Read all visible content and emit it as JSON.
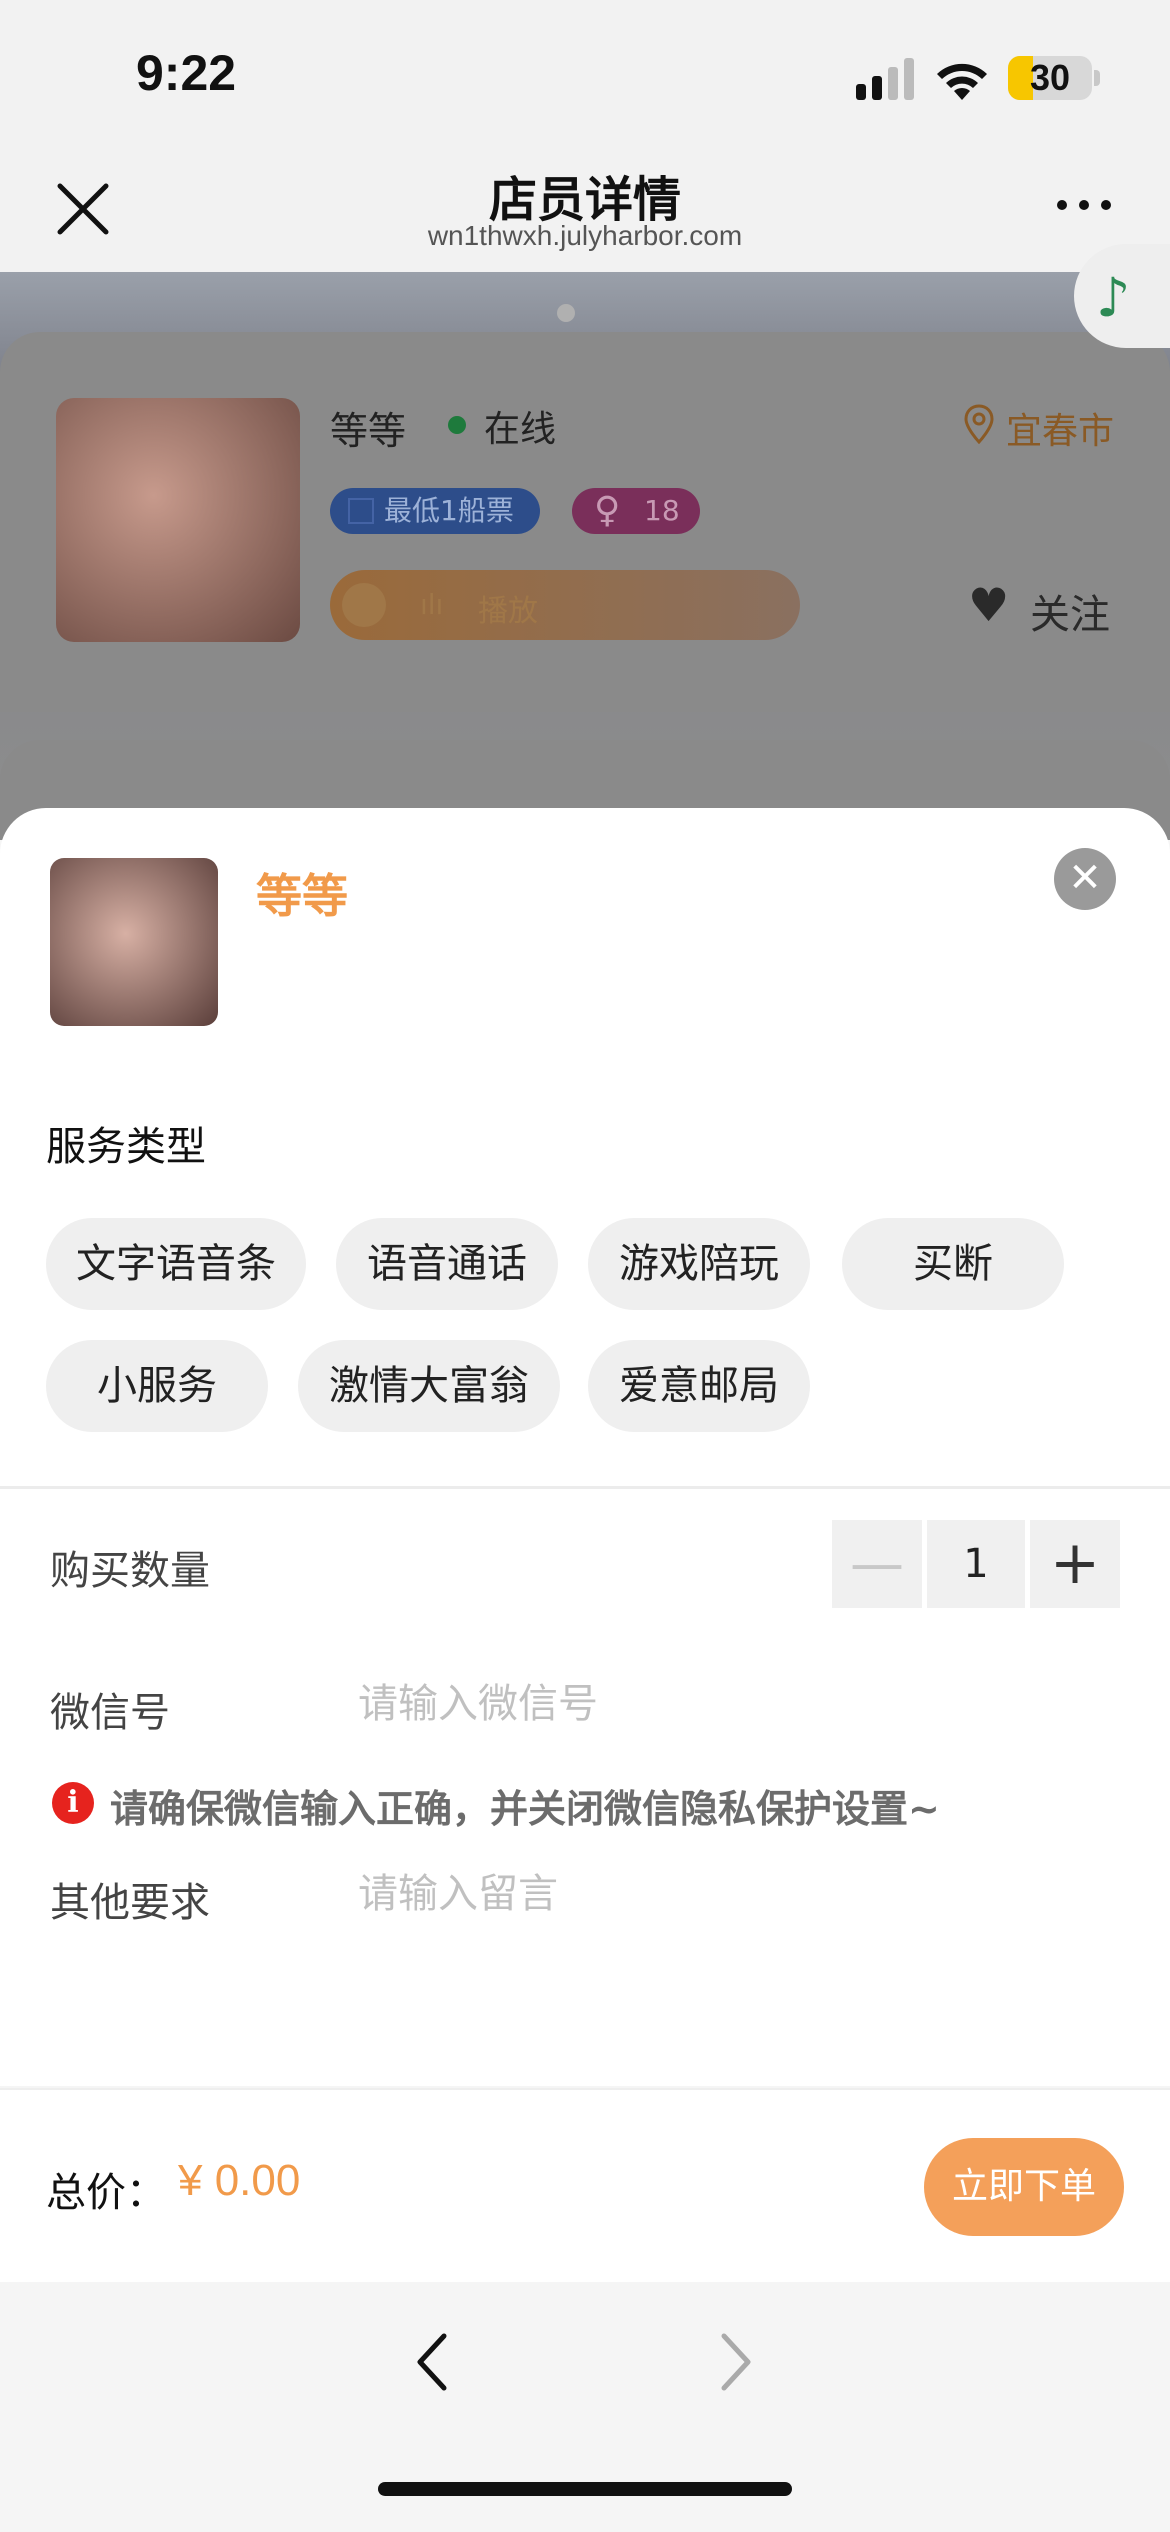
{
  "status_bar": {
    "time": "9:22",
    "battery": "30",
    "battery_level": 0.3
  },
  "nav": {
    "title": "店员详情",
    "url": "wn1thwxh.julyharbor.com"
  },
  "profile": {
    "name": "等等",
    "status": "在线",
    "location": "宜春市",
    "tag_price": "最低1船票",
    "tag_age": "18",
    "audio_label": "播放",
    "follow_label": "关注"
  },
  "sheet": {
    "name": "等等",
    "close_symbol": "✕",
    "service_title": "服务类型",
    "services": [
      "文字语音条",
      "语音通话",
      "游戏陪玩",
      "买断",
      "小服务",
      "激情大富翁",
      "爱意邮局"
    ],
    "quantity_label": "购买数量",
    "quantity": "1",
    "wechat_label": "微信号",
    "wechat_placeholder": "请输入微信号",
    "warning": "请确保微信输入正确，并关闭微信隐私保护设置~",
    "other_label": "其他要求",
    "other_placeholder": "请输入留言"
  },
  "footer": {
    "total_label": "总价：",
    "total_value": "¥ 0.00",
    "order_button": "立即下单"
  },
  "colors": {
    "accent": "#f19a4a",
    "warning": "#e6231e",
    "online": "#1e7a3c"
  }
}
